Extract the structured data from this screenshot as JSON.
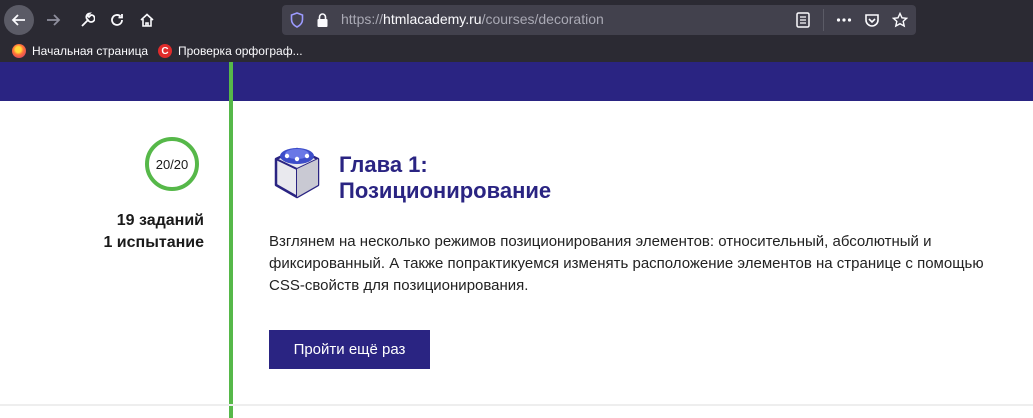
{
  "browser": {
    "url_host": "htmlacademy.ru",
    "url_path": "/courses/decoration",
    "url_scheme": "https://",
    "bookmarks": [
      {
        "label": "Начальная страница",
        "icon": "firefox-icon"
      },
      {
        "label": "Проверка орфограф...",
        "icon": "spellcheck-icon"
      }
    ]
  },
  "chapter": {
    "progress": "20/20",
    "tasks_count": "19 заданий",
    "trials_count": "1 испытание",
    "title_line1": "Глава 1:",
    "title_line2": "Позиционирование",
    "description": "Взглянем на несколько режимов позиционирования элементов: относительный, абсолютный и фиксированный. А также попрактикуемся изменять расположение элементов на странице с помощью CSS-свойств для позиционирования.",
    "retry_label": "Пройти ещё раз",
    "icon": "chapter-cube-icon"
  },
  "colors": {
    "brand": "#2a2482",
    "timeline": "#56b849",
    "chrome": "#2b2a33"
  }
}
